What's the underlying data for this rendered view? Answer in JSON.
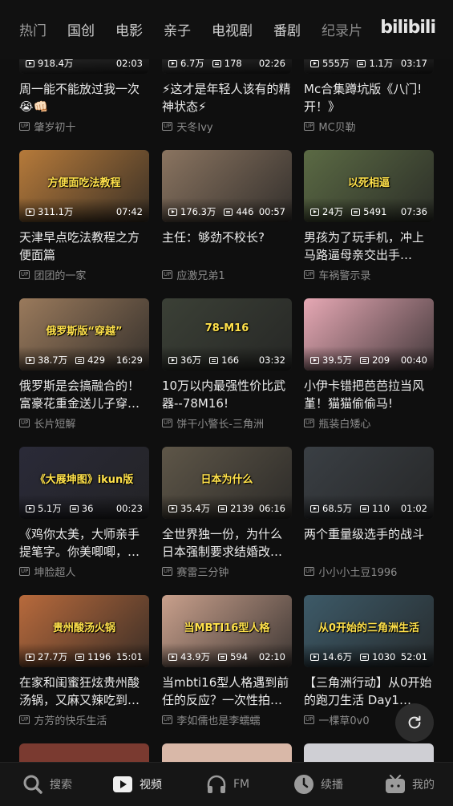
{
  "header": {
    "tabs": [
      "热门",
      "国创",
      "电影",
      "亲子",
      "电视剧",
      "番剧",
      "纪录片"
    ],
    "logo": "bilibili"
  },
  "top_partial": [
    {
      "views": "918.4万",
      "danmaku": "",
      "duration": "02:03",
      "title": "周一能不能放过我一次😭👊🏻",
      "author": "肇岁初十"
    },
    {
      "views": "6.7万",
      "danmaku": "178",
      "duration": "02:26",
      "title": "⚡这才是年轻人该有的精神状态⚡",
      "author": "天冬Ivy"
    },
    {
      "views": "555万",
      "danmaku": "1.1万",
      "duration": "03:17",
      "title": "Mc合集蹲坑版《八门!开！》",
      "author": "MC贝勒"
    }
  ],
  "videos": [
    {
      "views": "311.1万",
      "danmaku": "",
      "duration": "07:42",
      "title": "天津早点吃法教程之方便面篇",
      "author": "团团的一家",
      "thumb_text": "方便面吃法教程",
      "thumb_color": "#b67a3a"
    },
    {
      "views": "176.3万",
      "danmaku": "446",
      "duration": "00:57",
      "title": "主任：够劲不校长?",
      "author": "应激兄弟1",
      "thumb_text": "",
      "thumb_color": "#8a7460"
    },
    {
      "views": "24万",
      "danmaku": "5491",
      "duration": "07:36",
      "title": "男孩为了玩手机，冲上马路逼母亲交出手机！…",
      "author": "车祸警示录",
      "thumb_text": "以死相逼",
      "thumb_color": "#5b6a44"
    },
    {
      "views": "38.7万",
      "danmaku": "429",
      "duration": "16:29",
      "title": "俄罗斯是会搞融合的！富豪花重金送儿子穿越…",
      "author": "长片短解",
      "thumb_text": "俄罗斯版“穿越”",
      "thumb_color": "#9a7a5c"
    },
    {
      "views": "36万",
      "danmaku": "166",
      "duration": "03:32",
      "title": "10万以内最强性价比武器--78M16!",
      "author": "饼干小警长-三角洲",
      "thumb_text": "78-M16",
      "thumb_color": "#3b4036"
    },
    {
      "views": "39.5万",
      "danmaku": "209",
      "duration": "00:40",
      "title": "小伊卡错把芭芭拉当风堇！猫猫偷偷马!",
      "author": "瓶装白矮心",
      "thumb_text": "",
      "thumb_color": "#e6a8b4"
    },
    {
      "views": "5.1万",
      "danmaku": "36",
      "duration": "00:23",
      "title": "《鸡你太美，大师亲手提笔字。你美唧唧，搬…",
      "author": "坤脸超人",
      "thumb_text": "《大展坤图》ikun版",
      "thumb_color": "#2a2a38"
    },
    {
      "views": "35.4万",
      "danmaku": "2139",
      "duration": "06:16",
      "title": "全世界独一份，为什么日本强制要求结婚改…",
      "author": "赛雷三分钟",
      "thumb_text": "日本为什么",
      "thumb_color": "#5e5648"
    },
    {
      "views": "68.5万",
      "danmaku": "110",
      "duration": "01:02",
      "title": "两个重量级选手的战斗",
      "author": "小小小土豆1996",
      "thumb_text": "",
      "thumb_color": "#3a3f44"
    },
    {
      "views": "27.7万",
      "danmaku": "1196",
      "duration": "15:01",
      "title": "在家和闺蜜狂炫贵州酸汤锅，又麻又辣吃到扶…",
      "author": "方芳的快乐生活",
      "thumb_text": "贵州酸汤火锅",
      "thumb_color": "#b86a3c"
    },
    {
      "views": "43.9万",
      "danmaku": "594",
      "duration": "02:10",
      "title": "当mbti16型人格遇到前任的反应？一次性拍…",
      "author": "李如儒也是李蠕蠕",
      "thumb_text": "当MBTI16型人格",
      "thumb_color": "#c9a08c"
    },
    {
      "views": "14.6万",
      "danmaku": "1030",
      "duration": "52:01",
      "title": "【三角洲行动】从0开始的跑刀生活 Day1（超…",
      "author": "一棵草0v0",
      "thumb_text": "从0开始的三角洲生活",
      "thumb_color": "#3d5a68"
    }
  ],
  "bottom_nav": [
    {
      "label": "搜索",
      "icon": "search-icon"
    },
    {
      "label": "视频",
      "icon": "video-icon"
    },
    {
      "label": "FM",
      "icon": "headphones-icon"
    },
    {
      "label": "续播",
      "icon": "clock-icon"
    },
    {
      "label": "我的",
      "icon": "tv-icon"
    }
  ]
}
